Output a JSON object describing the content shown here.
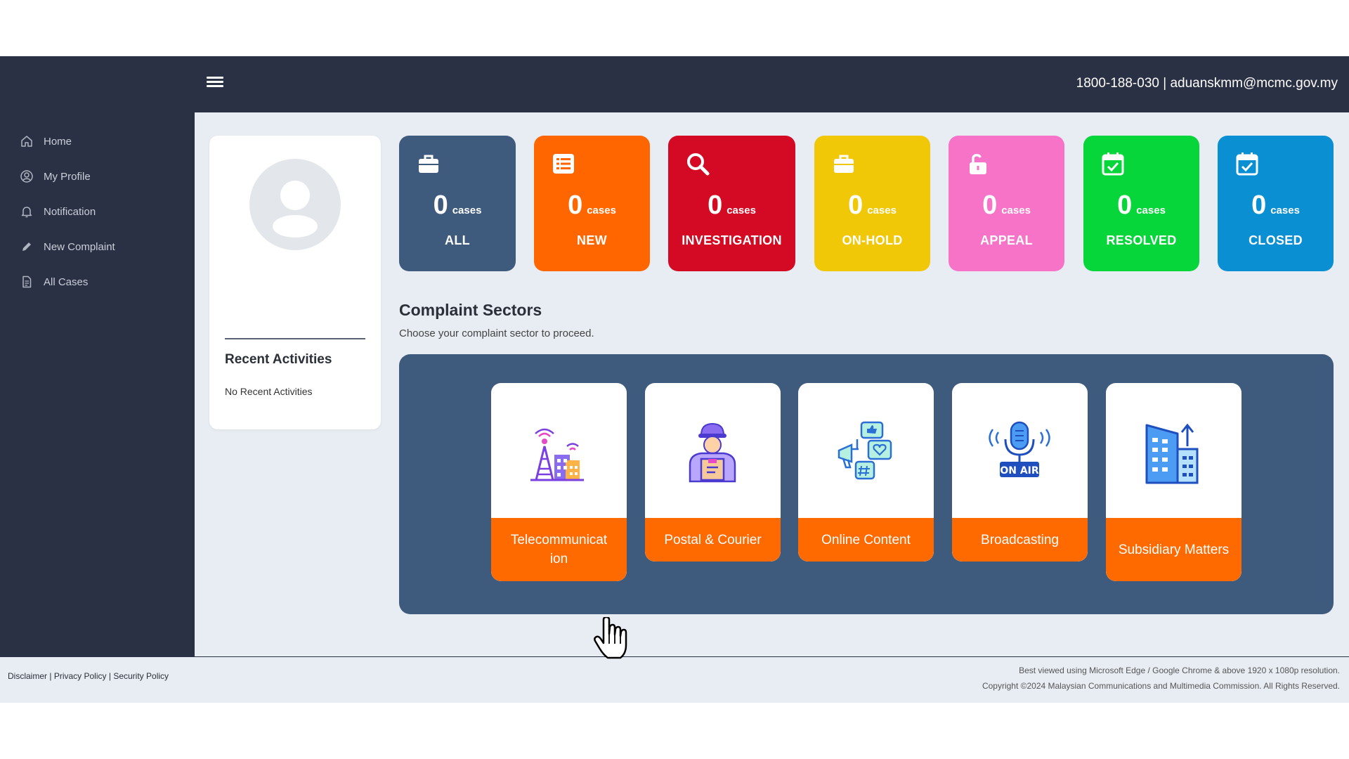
{
  "header": {
    "contact": "1800-188-030 | aduanskmm@mcmc.gov.my"
  },
  "sidebar": {
    "items": [
      {
        "label": "Home",
        "icon": "home-icon"
      },
      {
        "label": "My Profile",
        "icon": "user-circle-icon"
      },
      {
        "label": "Notification",
        "icon": "bell-icon"
      },
      {
        "label": "New Complaint",
        "icon": "pencil-icon"
      },
      {
        "label": "All Cases",
        "icon": "document-icon"
      }
    ]
  },
  "profile": {
    "recent_title": "Recent Activities",
    "recent_empty": "No Recent Activities"
  },
  "stats": [
    {
      "count": "0",
      "unit": "cases",
      "label": "ALL",
      "color": "#3e5a7c",
      "icon": "briefcase-icon"
    },
    {
      "count": "0",
      "unit": "cases",
      "label": "NEW",
      "color": "#ff6600",
      "icon": "list-icon"
    },
    {
      "count": "0",
      "unit": "cases",
      "label": "INVESTIGATION",
      "color": "#d40a24",
      "icon": "search-icon"
    },
    {
      "count": "0",
      "unit": "cases",
      "label": "ON-HOLD",
      "color": "#f0c808",
      "icon": "briefcase-icon"
    },
    {
      "count": "0",
      "unit": "cases",
      "label": "APPEAL",
      "color": "#f773c8",
      "icon": "unlock-icon"
    },
    {
      "count": "0",
      "unit": "cases",
      "label": "RESOLVED",
      "color": "#07d63a",
      "icon": "calendar-check-icon"
    },
    {
      "count": "0",
      "unit": "cases",
      "label": "CLOSED",
      "color": "#0b8fd3",
      "icon": "calendar-check-icon"
    }
  ],
  "sectors": {
    "title": "Complaint Sectors",
    "subtitle": "Choose your complaint sector to proceed.",
    "items": [
      {
        "label": "Telecommunicat ion",
        "icon": "telecom-tower-icon"
      },
      {
        "label": "Postal & Courier",
        "icon": "courier-icon"
      },
      {
        "label": "Online Content",
        "icon": "online-content-icon"
      },
      {
        "label": "Broadcasting",
        "icon": "on-air-microphone-icon"
      },
      {
        "label": "Subsidiary Matters",
        "icon": "buildings-icon"
      }
    ],
    "on_air_text": "ON AIR"
  },
  "footer": {
    "disclaimer": "Disclaimer",
    "privacy": "Privacy Policy",
    "security": "Security Policy",
    "sep": "|",
    "best_viewed": "Best viewed using Microsoft Edge / Google Chrome & above 1920 x 1080p resolution.",
    "copyright": "Copyright ©2024 Malaysian Communications and Multimedia Commission. All Rights Reserved."
  },
  "colors": {
    "sidebar": "#2b3144",
    "background": "#e8edf3",
    "accent": "#ff6a00",
    "panel": "#3e5a7c"
  }
}
